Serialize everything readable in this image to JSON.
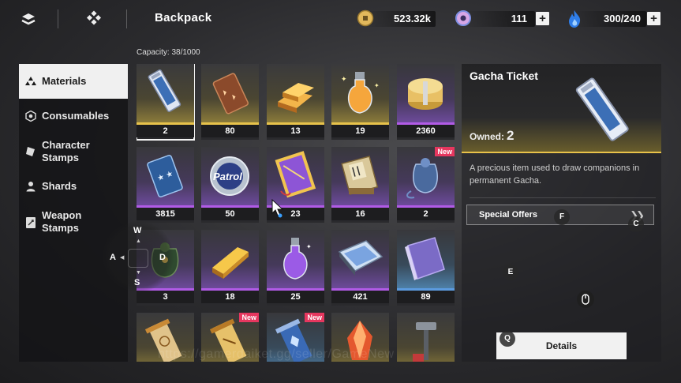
{
  "topbar": {
    "title": "Backpack",
    "icons": [
      "layers-icon",
      "diamond-grid-icon"
    ],
    "resources": [
      {
        "name": "coin-icon",
        "value": "523.32k",
        "has_plus": false,
        "color": "#d9b25a"
      },
      {
        "name": "crystal-icon",
        "value": "111",
        "has_plus": true,
        "color": "#c98ad6"
      },
      {
        "name": "stamina-flame-icon",
        "value": "300/240",
        "has_plus": true,
        "color": "#3d8ef0"
      }
    ],
    "plus_label": "+"
  },
  "nav": {
    "items": [
      {
        "label": "Materials",
        "icon": "materials-icon",
        "active": true
      },
      {
        "label": "Consumables",
        "icon": "consumables-icon",
        "active": false
      },
      {
        "label": "Character\nStamps",
        "icon": "character-stamp-icon",
        "active": false
      },
      {
        "label": "Shards",
        "icon": "shards-icon",
        "active": false
      },
      {
        "label": "Weapon\nStamps",
        "icon": "weapon-stamp-icon",
        "active": false
      }
    ]
  },
  "inventory": {
    "capacity": "Capacity: 38/1000",
    "new_label": "New",
    "items": [
      {
        "icon": "gacha-ticket-icon",
        "count": "2",
        "rarity": "gold",
        "selected": true,
        "new": false
      },
      {
        "icon": "bronze-ticket-icon",
        "count": "80",
        "rarity": "gold",
        "selected": false,
        "new": false
      },
      {
        "icon": "gold-bars-icon",
        "count": "13",
        "rarity": "gold",
        "selected": false,
        "new": false
      },
      {
        "icon": "gold-potion-icon",
        "count": "19",
        "rarity": "gold",
        "selected": false,
        "new": false
      },
      {
        "icon": "coin-stack-icon",
        "count": "2360",
        "rarity": "purple",
        "selected": false,
        "new": false
      },
      {
        "icon": "blue-ticket-icon",
        "count": "3815",
        "rarity": "purple",
        "selected": false,
        "new": false
      },
      {
        "icon": "patrol-badge-icon",
        "count": "50",
        "rarity": "purple",
        "selected": false,
        "new": false
      },
      {
        "icon": "purple-tome-icon",
        "count": "23",
        "rarity": "purple",
        "selected": false,
        "new": false
      },
      {
        "icon": "scroll-bundle-icon",
        "count": "16",
        "rarity": "purple",
        "selected": false,
        "new": false
      },
      {
        "icon": "blue-pouch-icon",
        "count": "2",
        "rarity": "purple",
        "selected": false,
        "new": true
      },
      {
        "icon": "green-pouch-icon",
        "count": "3",
        "rarity": "purple",
        "selected": false,
        "new": false
      },
      {
        "icon": "gold-ingot-icon",
        "count": "18",
        "rarity": "purple",
        "selected": false,
        "new": false
      },
      {
        "icon": "purple-potion-icon",
        "count": "25",
        "rarity": "purple",
        "selected": false,
        "new": false
      },
      {
        "icon": "map-sheet-icon",
        "count": "421",
        "rarity": "purple",
        "selected": false,
        "new": false
      },
      {
        "icon": "purple-book-icon",
        "count": "89",
        "rarity": "blue",
        "selected": false,
        "new": false
      },
      {
        "icon": "gold-scroll-icon",
        "count": "",
        "rarity": "gold",
        "selected": false,
        "new": false
      },
      {
        "icon": "gold-scroll-icon",
        "count": "",
        "rarity": "gold",
        "selected": false,
        "new": true
      },
      {
        "icon": "blue-scroll-icon",
        "count": "",
        "rarity": "blue",
        "selected": false,
        "new": true
      },
      {
        "icon": "fire-crystal-icon",
        "count": "",
        "rarity": "gold",
        "selected": false,
        "new": false
      },
      {
        "icon": "hammer-tool-icon",
        "count": "",
        "rarity": "gold",
        "selected": false,
        "new": false
      }
    ]
  },
  "detail": {
    "title": "Gacha Ticket",
    "owned_label": "Owned:",
    "owned_value": "2",
    "description": "A precious item used to draw companions in permanent Gacha.",
    "offers_label": "Special Offers",
    "details_button": "Details"
  },
  "key_hints": {
    "wasd": {
      "w": "W",
      "a": "A",
      "s": "S",
      "d": "D"
    },
    "f": "F",
    "c": "C",
    "e": "E",
    "q": "Q"
  },
  "watermark": "https://gamerdaiket.gg/seller/GameNew"
}
